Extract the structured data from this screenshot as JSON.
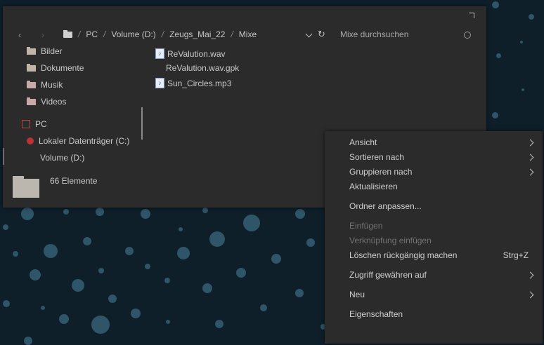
{
  "desktop": {
    "background": "#0e1f2a",
    "dot_color": "#2e5568"
  },
  "explorer": {
    "breadcrumb": [
      "PC",
      "Volume (D:)",
      "Zeugs_Mai_22",
      "Mixe"
    ],
    "search_placeholder": "Mixe durchsuchen",
    "nav": {
      "bilder": "Bilder",
      "dokumente": "Dokumente",
      "musik": "Musik",
      "videos": "Videos",
      "pc": "PC",
      "drive_c": "Lokaler Datenträger (C:)",
      "drive_d": "Volume (D:)"
    },
    "files": [
      "ReValution.wav",
      "ReValution.wav.gpk",
      "Sun_Circles.mp3"
    ],
    "item_count": "66 Elemente"
  },
  "context_menu": {
    "ansicht": "Ansicht",
    "sortieren": "Sortieren nach",
    "gruppieren": "Gruppieren nach",
    "aktualisieren": "Aktualisieren",
    "ordner_anpassen": "Ordner anpassen...",
    "einfuegen": "Einfügen",
    "verknuepfung": "Verknüpfung einfügen",
    "loeschen": "Löschen rückgängig machen",
    "loeschen_shortcut": "Strg+Z",
    "zugriff": "Zugriff gewähren auf",
    "neu": "Neu",
    "eigenschaften": "Eigenschaften"
  }
}
